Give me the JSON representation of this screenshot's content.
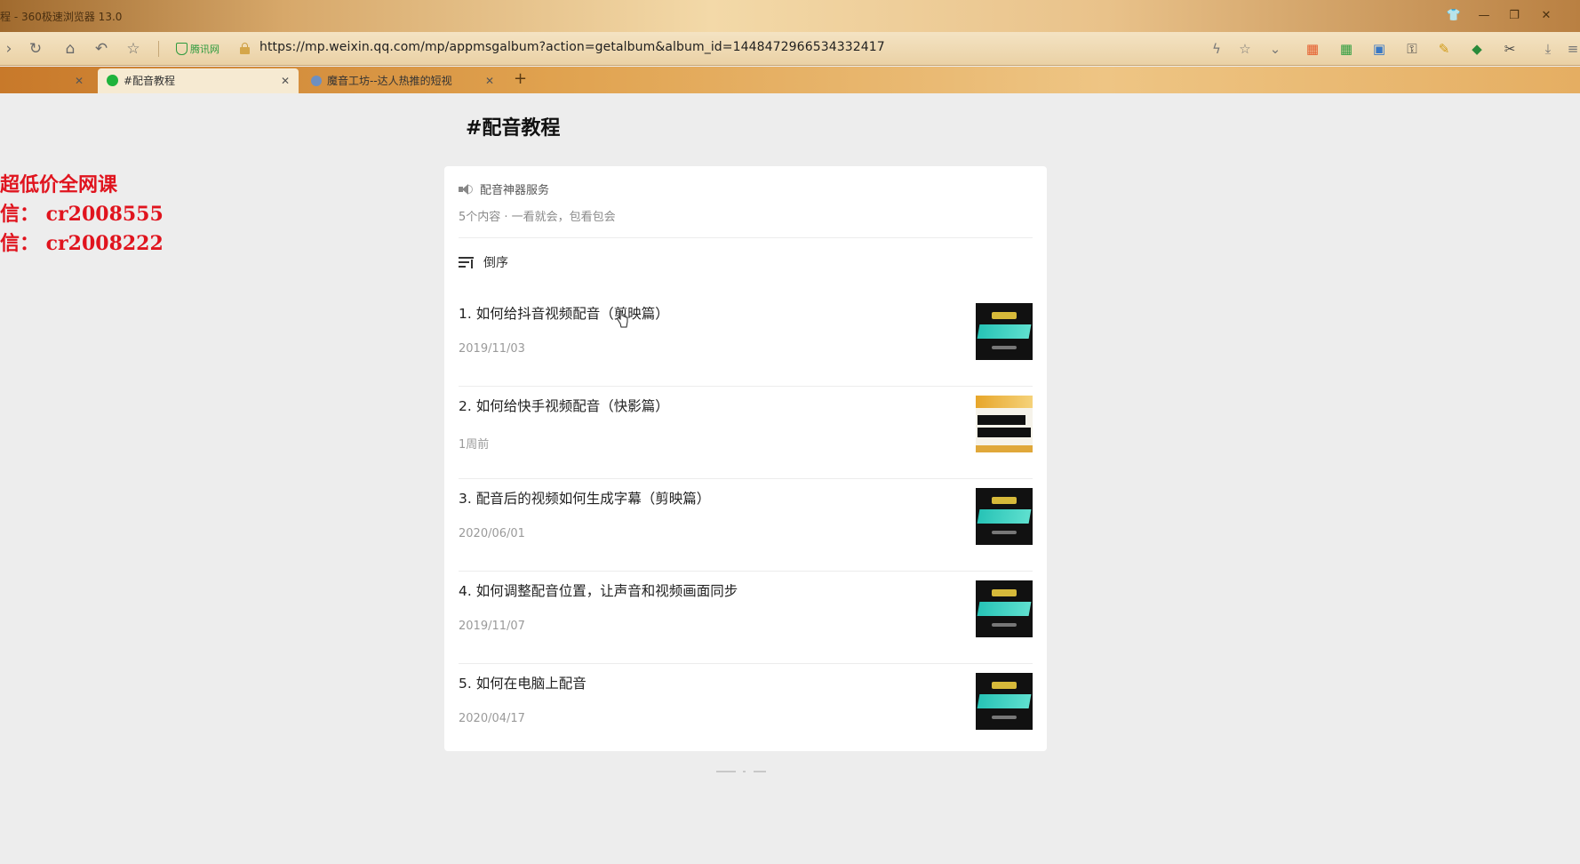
{
  "window": {
    "title": "程 - 360极速浏览器 13.0"
  },
  "navbar": {
    "secure_label": "腾讯网",
    "url": "https://mp.weixin.qq.com/mp/appmsgalbum?action=getalbum&album_id=1448472966534332417"
  },
  "tabs": [
    {
      "label": "",
      "active": false
    },
    {
      "label": "#配音教程",
      "active": true
    },
    {
      "label": "魔音工坊--达人热推的短视",
      "active": false
    }
  ],
  "watermark": {
    "line1": "超低价全网课",
    "line2": "信：  cr2008555",
    "line3": "信：  cr2008222"
  },
  "album": {
    "title": "#配音教程",
    "publisher": "配音神器服务",
    "description": "5个内容 · 一看就会，包看包会",
    "sort_label": "倒序"
  },
  "articles": [
    {
      "title": "1. 如何给抖音视频配音（剪映篇）",
      "date": "2019/11/03",
      "thumb_style": "dark"
    },
    {
      "title": "2. 如何给快手视频配音（快影篇）",
      "date": "1周前",
      "thumb_style": "light"
    },
    {
      "title": "3. 配音后的视频如何生成字幕（剪映篇）",
      "date": "2020/06/01",
      "thumb_style": "dark"
    },
    {
      "title": "4. 如何调整配音位置，让声音和视频画面同步",
      "date": "2019/11/07",
      "thumb_style": "dark"
    },
    {
      "title": "5. 如何在电脑上配音",
      "date": "2020/04/17",
      "thumb_style": "dark"
    }
  ],
  "colors": {
    "watermark_red": "#e0141e",
    "wechat_green": "#1fb33c",
    "page_bg": "#ededed"
  }
}
